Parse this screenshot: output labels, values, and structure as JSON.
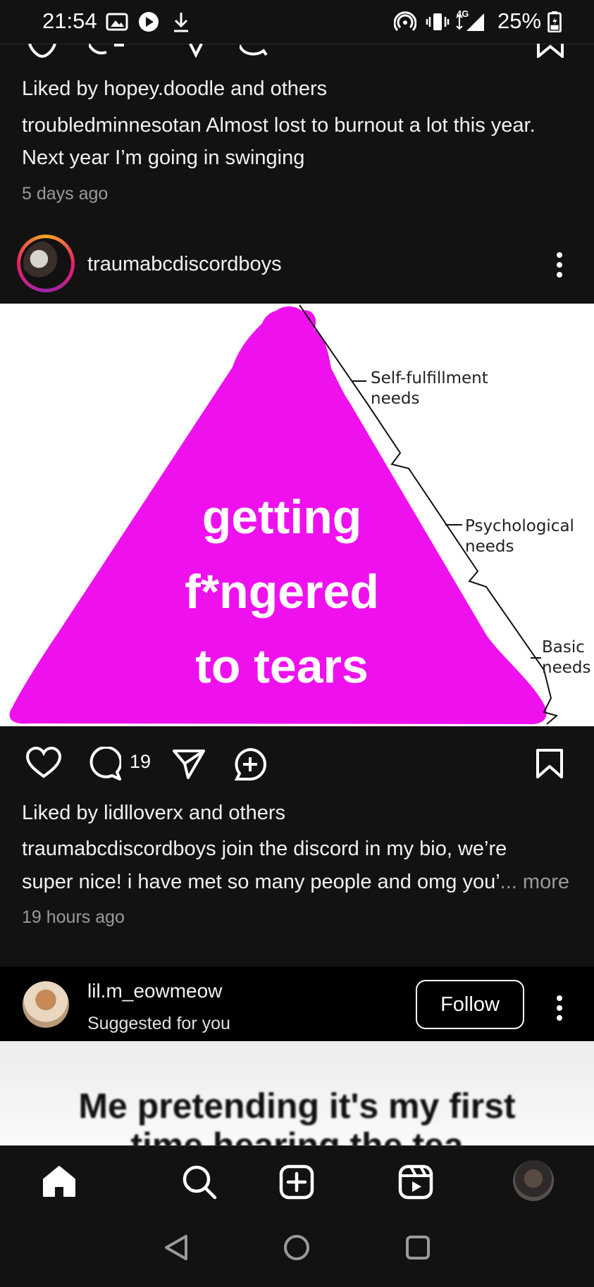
{
  "status_bar": {
    "time": "21:54",
    "battery": "25%",
    "network": "4G",
    "icons": [
      "gallery-icon",
      "play-store-icon",
      "download-icon",
      "hotspot-icon",
      "vibrate-icon",
      "signal-icon",
      "battery-icon"
    ]
  },
  "prev_post": {
    "likes": "Liked by hopey.doodle and others",
    "caption_line1": "troubledminnesotan Almost lost to burnout a lot this year.",
    "caption_line2": "Next year I’m going in swinging",
    "time": "5 days ago"
  },
  "post": {
    "username": "traumabcdiscordboys",
    "image": {
      "main_text": [
        "getting",
        "f*ngered",
        "to tears"
      ],
      "levels": [
        {
          "line1": "Self-fulfillment",
          "line2": "needs"
        },
        {
          "line1": "Psychological",
          "line2": "needs"
        },
        {
          "line1": "Basic",
          "line2": "needs"
        }
      ],
      "fill_color": "#ee11ee"
    },
    "comment_count": "19",
    "likes": "Liked by lidlloverx and others",
    "caption_line1": "traumabcdiscordboys join the discord in my bio, we’re",
    "caption_line2": "super nice! i have met so many people and omg you’",
    "caption_ellipsis": "...",
    "more_label": "more",
    "time": "19 hours ago"
  },
  "suggested": {
    "username": "lil.m_eowmeow",
    "subtitle": "Suggested for you",
    "follow_label": "Follow",
    "meme_text": "Me pretending it's my first",
    "meme_text2": "time hearing the tea"
  },
  "bottom_nav": [
    "home-icon",
    "search-icon",
    "create-icon",
    "reels-icon",
    "profile-avatar"
  ],
  "system_nav": [
    "back-icon",
    "home-circle-icon",
    "recents-icon"
  ]
}
